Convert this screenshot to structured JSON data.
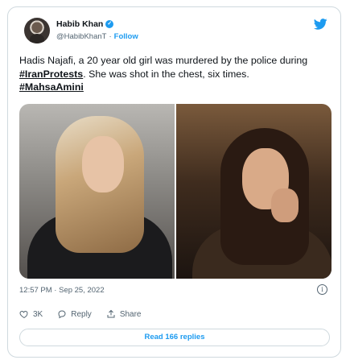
{
  "author": {
    "name": "Habib Khan",
    "handle": "@HabibKhanT",
    "follow_label": "Follow",
    "separator": "·"
  },
  "tweet": {
    "text_before": "Hadis Najafi, a 20 year old girl was murdered by the police during ",
    "hashtag1": "#IranProtests",
    "text_after": ". She was shot in the chest, six times.",
    "hashtag2": "#MahsaAmini"
  },
  "meta": {
    "timestamp": "12:57 PM · Sep 25, 2022"
  },
  "actions": {
    "like_count": "3K",
    "reply_label": "Reply",
    "share_label": "Share"
  },
  "footer": {
    "read_replies_label": "Read 166 replies"
  },
  "colors": {
    "accent": "#1d9bf0",
    "text": "#0f1419",
    "muted": "#536471",
    "border": "#cfd9de"
  },
  "icons": [
    "verified-badge-icon",
    "twitter-bird-icon",
    "info-icon",
    "heart-icon",
    "reply-icon",
    "share-icon"
  ]
}
